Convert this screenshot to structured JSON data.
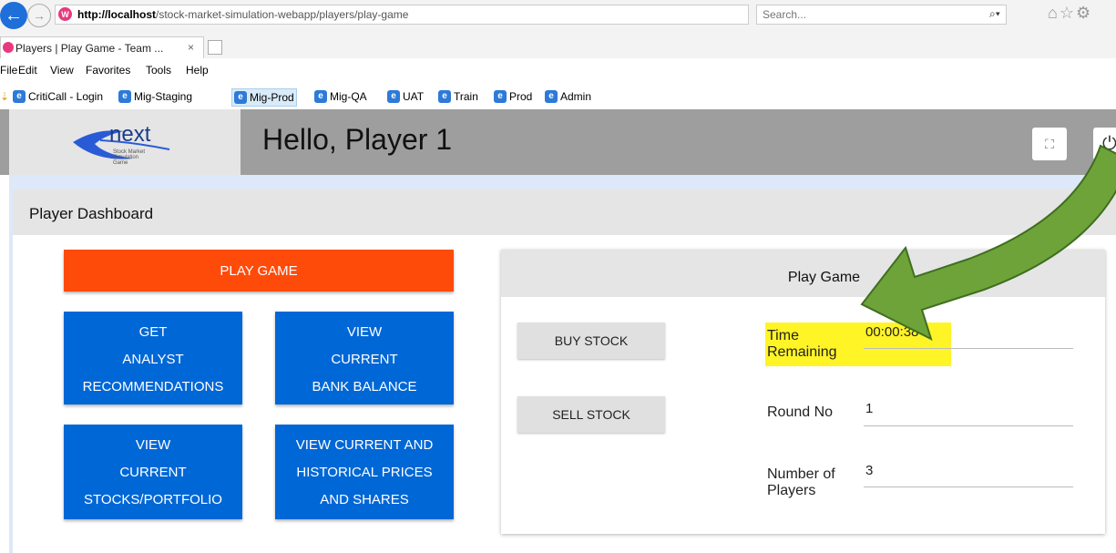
{
  "browser": {
    "url_host": "http://localhost",
    "url_path": "/stock-market-simulation-webapp/players/play-game",
    "url_controls": "▾ Ċ",
    "search_placeholder": "Search...",
    "tab_title": "Players | Play Game - Team ...",
    "tab_close": "×",
    "menu": [
      "File",
      "Edit",
      "View",
      "Favorites",
      "Tools",
      "Help"
    ],
    "favorites": [
      "CritiCall - Login",
      "Mig-Staging",
      "Mig-Prod",
      "Mig-QA",
      "UAT",
      "Train",
      "Prod",
      "Admin"
    ],
    "active_favorite": "Mig-Prod"
  },
  "header": {
    "logo_text": "next",
    "logo_subtext": "Stock Market Simulation Game",
    "greeting": "Hello, Player 1"
  },
  "dashboard": {
    "title": "Player Dashboard",
    "play_game_label": "PLAY GAME",
    "buttons": [
      {
        "lines": [
          "GET",
          "ANALYST",
          "RECOMMENDATIONS"
        ]
      },
      {
        "lines": [
          "VIEW",
          "CURRENT",
          "BANK BALANCE"
        ]
      },
      {
        "lines": [
          "VIEW",
          "CURRENT",
          "STOCKS/PORTFOLIO"
        ]
      },
      {
        "lines": [
          "VIEW CURRENT AND",
          "HISTORICAL PRICES",
          "AND SHARES"
        ]
      }
    ]
  },
  "play_game": {
    "title": "Play Game",
    "buy_label": "BUY STOCK",
    "sell_label": "SELL STOCK",
    "time_label_1": "Time",
    "time_label_2": "Remaining",
    "time_value": "00:00:38",
    "round_label": "Round No",
    "round_value": "1",
    "players_label_1": "Number of",
    "players_label_2": "Players",
    "players_value": "3"
  },
  "colors": {
    "play_button": "#ff4b0a",
    "blue_button": "#0067d6",
    "header_bg": "#9e9e9e",
    "highlight": "#fff200",
    "arrow": "#6ea33a"
  }
}
